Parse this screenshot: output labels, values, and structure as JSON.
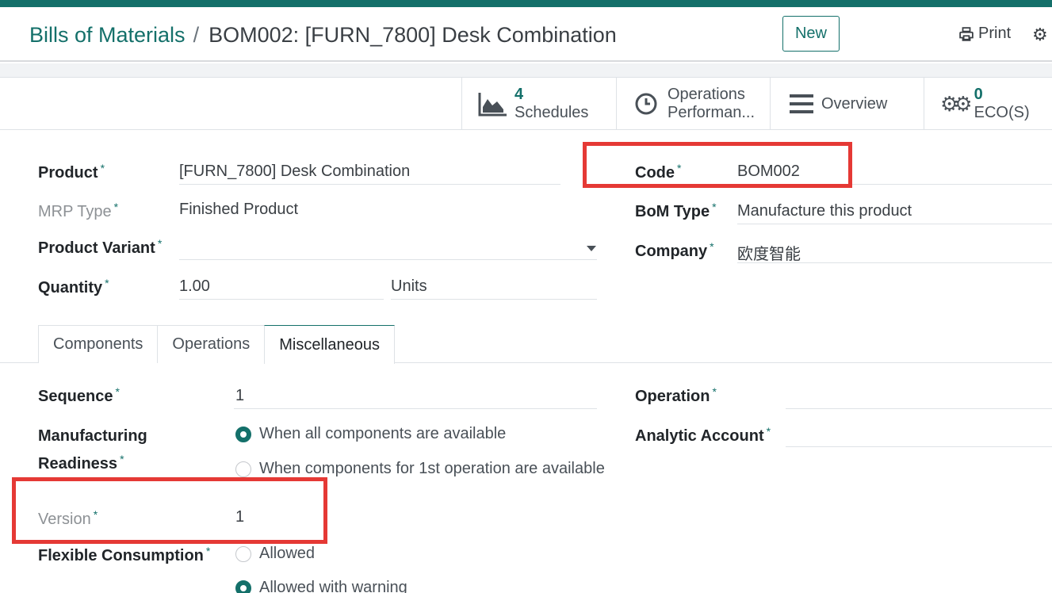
{
  "header": {
    "breadcrumb_parent": "Bills of Materials",
    "breadcrumb_separator": "/",
    "breadcrumb_current": "BOM002: [FURN_7800] Desk Combination",
    "new_label": "New",
    "print_label": "Print",
    "print_icon": "printer-icon",
    "settings_icon": "gear-icon"
  },
  "smart_buttons": {
    "schedules": {
      "count": "4",
      "label": "Schedules",
      "icon": "area-chart-icon"
    },
    "operations": {
      "label1": "Operations",
      "label2": "Performan...",
      "icon": "clock-icon"
    },
    "overview": {
      "label": "Overview",
      "icon": "bars-icon"
    },
    "eco": {
      "count": "0",
      "label": "ECO(S)",
      "icon": "cogs-icon"
    }
  },
  "form": {
    "product_label": "Product",
    "product_value": "[FURN_7800] Desk Combination",
    "mrp_type_label": "MRP Type",
    "mrp_type_value": "Finished Product",
    "variant_label": "Product Variant",
    "variant_value": "",
    "quantity_label": "Quantity",
    "quantity_value": "1.00",
    "uom_value": "Units",
    "code_label": "Code",
    "code_value": "BOM002",
    "bom_type_label": "BoM Type",
    "bom_type_value": "Manufacture this product",
    "company_label": "Company",
    "company_value": "欧度智能",
    "required_mark": "*"
  },
  "tabs": [
    "Components",
    "Operations",
    "Miscellaneous"
  ],
  "active_tab": "Miscellaneous",
  "misc": {
    "sequence_label": "Sequence",
    "sequence_value": "1",
    "readiness_label1": "Manufacturing",
    "readiness_label2": "Readiness",
    "readiness_options": [
      "When all components are available",
      "When components for 1st operation are available"
    ],
    "readiness_selected": 0,
    "version_label": "Version",
    "version_value": "1",
    "flexible_label": "Flexible Consumption",
    "flexible_options": [
      "Allowed",
      "Allowed with warning"
    ],
    "flexible_selected": 1,
    "operation_label": "Operation",
    "operation_value": "",
    "analytic_label": "Analytic Account",
    "analytic_value": ""
  },
  "colors": {
    "brand": "#14706a",
    "highlight": "#e53935"
  }
}
